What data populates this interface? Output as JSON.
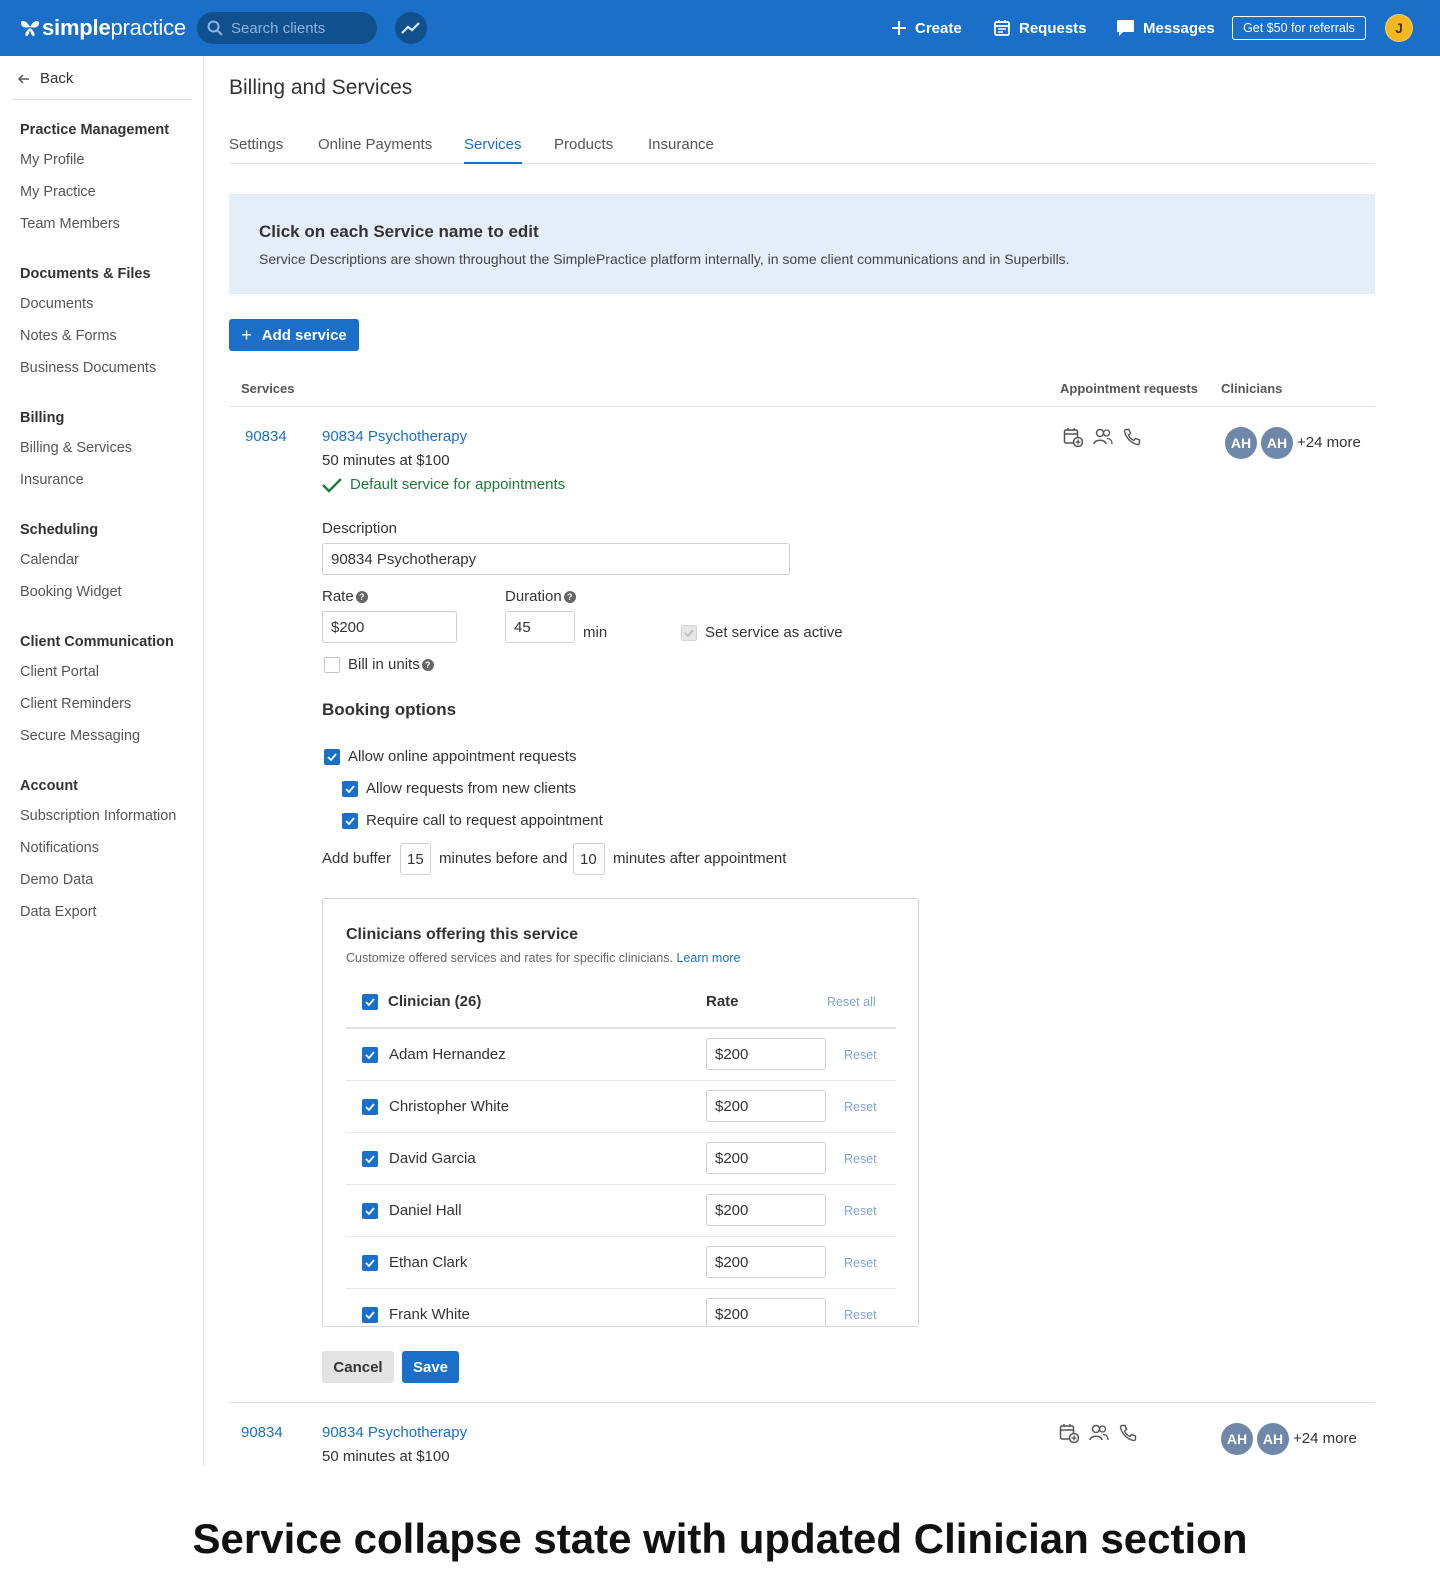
{
  "topbar": {
    "logo_bold": "simple",
    "logo_light": "practice",
    "search_placeholder": "Search clients",
    "create": "Create",
    "requests": "Requests",
    "messages": "Messages",
    "referral": "Get $50 for referrals",
    "user_initial": "J"
  },
  "sidebar": {
    "back": "Back",
    "sections": [
      {
        "title": "Practice Management",
        "items": [
          "My Profile",
          "My Practice",
          "Team Members"
        ]
      },
      {
        "title": "Documents & Files",
        "items": [
          "Documents",
          "Notes & Forms",
          "Business Documents"
        ]
      },
      {
        "title": "Billing",
        "items": [
          "Billing & Services",
          "Insurance"
        ]
      },
      {
        "title": "Scheduling",
        "items": [
          "Calendar",
          "Booking Widget"
        ]
      },
      {
        "title": "Client Communication",
        "items": [
          "Client Portal",
          "Client Reminders",
          "Secure Messaging"
        ]
      },
      {
        "title": "Account",
        "items": [
          "Subscription Information",
          "Notifications",
          "Demo Data",
          "Data Export"
        ]
      }
    ]
  },
  "page": {
    "title": "Billing and Services",
    "tabs": [
      "Settings",
      "Online Payments",
      "Services",
      "Products",
      "Insurance"
    ],
    "active_tab": "Services"
  },
  "banner": {
    "title": "Click on each Service name to edit",
    "description": "Service Descriptions are shown throughout the SimplePractice platform internally, in some client communications and in Superbills."
  },
  "add_service": "Add service",
  "columns": {
    "services": "Services",
    "appointment_requests": "Appointment requests",
    "clinicians": "Clinicians"
  },
  "service1": {
    "code": "90834",
    "name": "90834 Psychotherapy",
    "meta": "50 minutes at $100",
    "default": "Default service for appointments",
    "avatars": [
      "AH",
      "AH"
    ],
    "more": "+24 more"
  },
  "form": {
    "description_label": "Description",
    "description_value": "90834 Psychotherapy",
    "rate_label": "Rate",
    "rate_value": "$200",
    "duration_label": "Duration",
    "duration_value": "45",
    "duration_unit": "min",
    "active_label": "Set service as active",
    "bill_units_label": "Bill in units",
    "booking_title": "Booking options",
    "allow_online": "Allow online appointment requests",
    "allow_new": "Allow requests from new clients",
    "require_call": "Require call to request appointment",
    "buffer_prefix": "Add buffer",
    "buffer_before": "15",
    "buffer_mid": "minutes before and",
    "buffer_after": "10",
    "buffer_suffix": "minutes after appointment"
  },
  "clinicians_card": {
    "title": "Clinicians offering this service",
    "subtitle": "Customize offered services and rates for specific clinicians.",
    "learn_more": "Learn more",
    "header_clinician": "Clinician (26)",
    "header_rate": "Rate",
    "reset_all": "Reset all",
    "reset": "Reset",
    "rows": [
      {
        "name": "Adam Hernandez",
        "rate": "$200"
      },
      {
        "name": "Christopher White",
        "rate": "$200"
      },
      {
        "name": "David Garcia",
        "rate": "$200"
      },
      {
        "name": "Daniel Hall",
        "rate": "$200"
      },
      {
        "name": "Ethan Clark",
        "rate": "$200"
      },
      {
        "name": "Frank White",
        "rate": "$200"
      }
    ]
  },
  "actions": {
    "cancel": "Cancel",
    "save": "Save"
  },
  "service2": {
    "code": "90834",
    "name": "90834 Psychotherapy",
    "meta": "50 minutes at $100",
    "avatars": [
      "AH",
      "AH"
    ],
    "more": "+24 more"
  },
  "caption": "Service collapse state with updated Clinician section"
}
